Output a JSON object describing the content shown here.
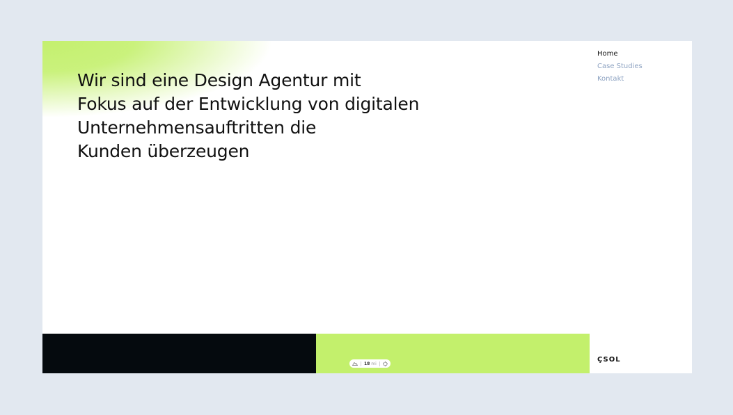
{
  "hero": {
    "lines": [
      "Wir sind eine Design Agentur mit",
      "Fokus auf der Entwicklung von digitalen",
      "Unternehmensauftritten die",
      "Kunden überzeugen"
    ]
  },
  "nav": {
    "items": [
      {
        "label": "Home",
        "active": true
      },
      {
        "label": "Case Studies",
        "active": false
      },
      {
        "label": "Kontakt",
        "active": false
      }
    ]
  },
  "widget": {
    "value": "18",
    "unit": "mi",
    "icons": [
      "mountain-icon",
      "target-icon"
    ]
  },
  "brand": {
    "logo": "ÇSOL"
  },
  "colors": {
    "background": "#e2e8f0",
    "accent_green": "#c3f06c",
    "dark_panel": "#050a0e",
    "nav_inactive": "#8ea3c2",
    "text": "#111111"
  }
}
